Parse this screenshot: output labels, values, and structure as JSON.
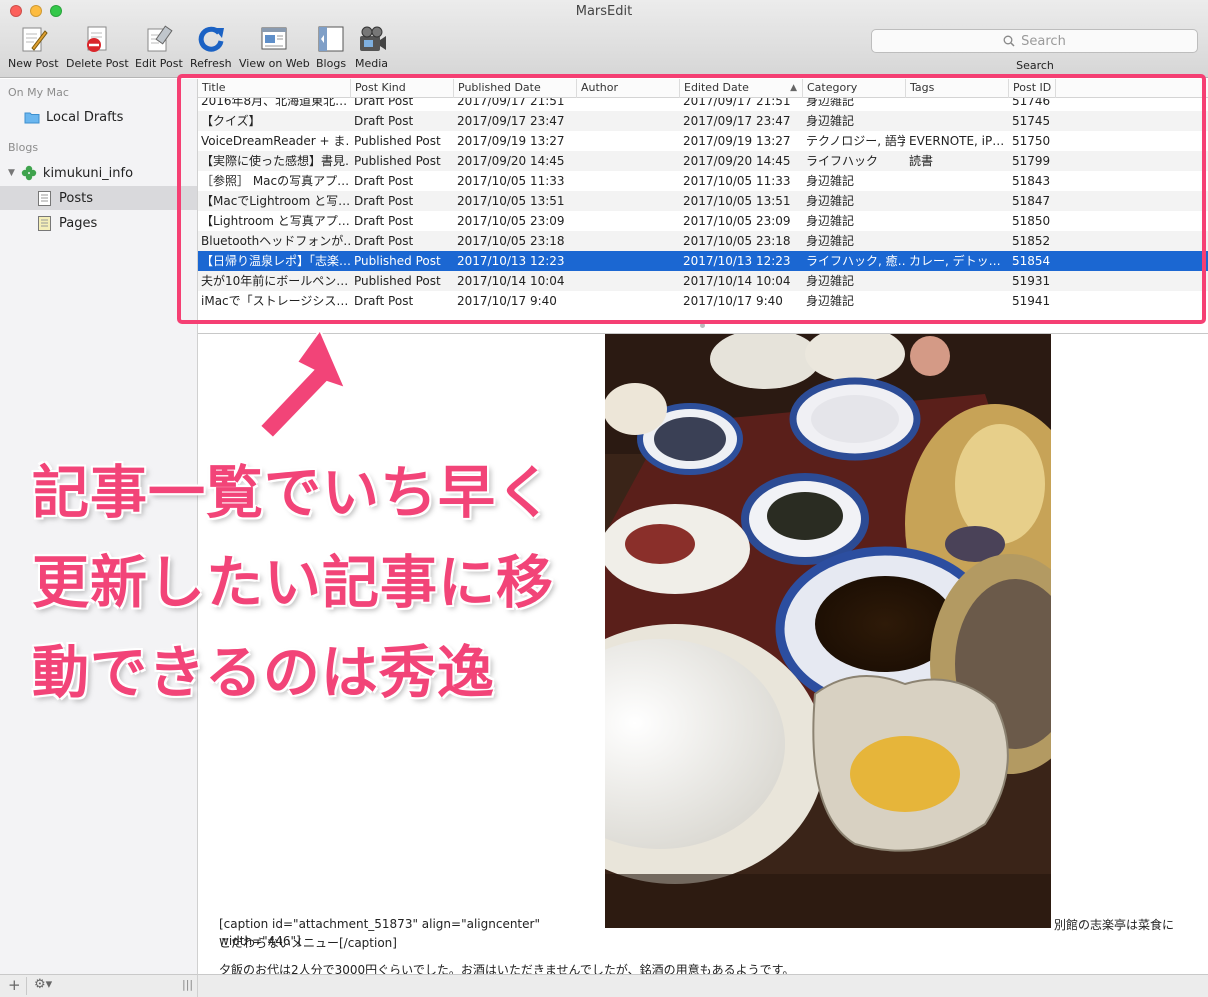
{
  "window": {
    "title": "MarsEdit"
  },
  "toolbar": {
    "new_post": "New Post",
    "delete_post": "Delete Post",
    "edit_post": "Edit Post",
    "refresh": "Refresh",
    "view_on_web": "View on Web",
    "blogs": "Blogs",
    "media": "Media",
    "search_placeholder": "Search",
    "search_label": "Search"
  },
  "sidebar": {
    "on_my_mac_header": "On My Mac",
    "local_drafts": "Local Drafts",
    "blogs_header": "Blogs",
    "blog_name": "kimukuni_info",
    "posts": "Posts",
    "pages": "Pages"
  },
  "table": {
    "columns": [
      "Title",
      "Post Kind",
      "Published Date",
      "Author",
      "Edited Date",
      "Category",
      "Tags",
      "Post ID"
    ],
    "sort_column": "Edited Date",
    "rows": [
      {
        "title": "2016年8月、北海道東北…",
        "kind": "Draft Post",
        "published": "2017/09/17 21:51",
        "author": "",
        "edited": "2017/09/17 21:51",
        "category": "身辺雑記",
        "tags": "",
        "id": "51746"
      },
      {
        "title": "【クイズ】",
        "kind": "Draft Post",
        "published": "2017/09/17 23:47",
        "author": "",
        "edited": "2017/09/17 23:47",
        "category": "身辺雑記",
        "tags": "",
        "id": "51745"
      },
      {
        "title": "VoiceDreamReader + ま…",
        "kind": "Published Post",
        "published": "2017/09/19 13:27",
        "author": "",
        "edited": "2017/09/19 13:27",
        "category": "テクノロジー, 語学",
        "tags": "EVERNOTE, iP…",
        "id": "51750"
      },
      {
        "title": "【実際に使った感想】書見…",
        "kind": "Published Post",
        "published": "2017/09/20 14:45",
        "author": "",
        "edited": "2017/09/20 14:45",
        "category": "ライフハック",
        "tags": "読書",
        "id": "51799"
      },
      {
        "title": "［参照］ Macの写真アプ…",
        "kind": "Draft Post",
        "published": "2017/10/05 11:33",
        "author": "",
        "edited": "2017/10/05 11:33",
        "category": "身辺雑記",
        "tags": "",
        "id": "51843"
      },
      {
        "title": "【MacでLightroom と写…",
        "kind": "Draft Post",
        "published": "2017/10/05 13:51",
        "author": "",
        "edited": "2017/10/05 13:51",
        "category": "身辺雑記",
        "tags": "",
        "id": "51847"
      },
      {
        "title": "【Lightroom と写真アプ…",
        "kind": "Draft Post",
        "published": "2017/10/05 23:09",
        "author": "",
        "edited": "2017/10/05 23:09",
        "category": "身辺雑記",
        "tags": "",
        "id": "51850"
      },
      {
        "title": "Bluetoothヘッドフォンが…",
        "kind": "Draft Post",
        "published": "2017/10/05 23:18",
        "author": "",
        "edited": "2017/10/05 23:18",
        "category": "身辺雑記",
        "tags": "",
        "id": "51852"
      },
      {
        "title": "【日帰り温泉レポ】「志楽…",
        "kind": "Published Post",
        "published": "2017/10/13 12:23",
        "author": "",
        "edited": "2017/10/13 12:23",
        "category": "ライフハック, 癒…",
        "tags": "カレー, デトッ…",
        "id": "51854",
        "selected": true
      },
      {
        "title": "夫が10年前にボールペン…",
        "kind": "Published Post",
        "published": "2017/10/14 10:04",
        "author": "",
        "edited": "2017/10/14 10:04",
        "category": "身辺雑記",
        "tags": "",
        "id": "51931"
      },
      {
        "title": "iMacで「ストレージシス…",
        "kind": "Draft Post",
        "published": "2017/10/17 9:40",
        "author": "",
        "edited": "2017/10/17 9:40",
        "category": "身辺雑記",
        "tags": "",
        "id": "51941"
      }
    ]
  },
  "editor": {
    "caption_open": "[caption id=\"attachment_51873\" align=\"aligncenter\" width=\"446\"]",
    "caption_tail": "別館の志楽亭は菜食に",
    "caption_close": "こだわらないメニュー[/caption]",
    "body_line": "夕飯のお代は2人分で3000円ぐらいでした。お酒はいただきませんでしたが、銘酒の用意もあるようです。"
  },
  "annotation": {
    "line1": "記事一覧でいち早く",
    "line2": "更新したい記事に移",
    "line3": "動できるのは秀逸",
    "color": "#f24478"
  },
  "colors": {
    "highlight": "#f53f73",
    "selection": "#1b67d2"
  }
}
